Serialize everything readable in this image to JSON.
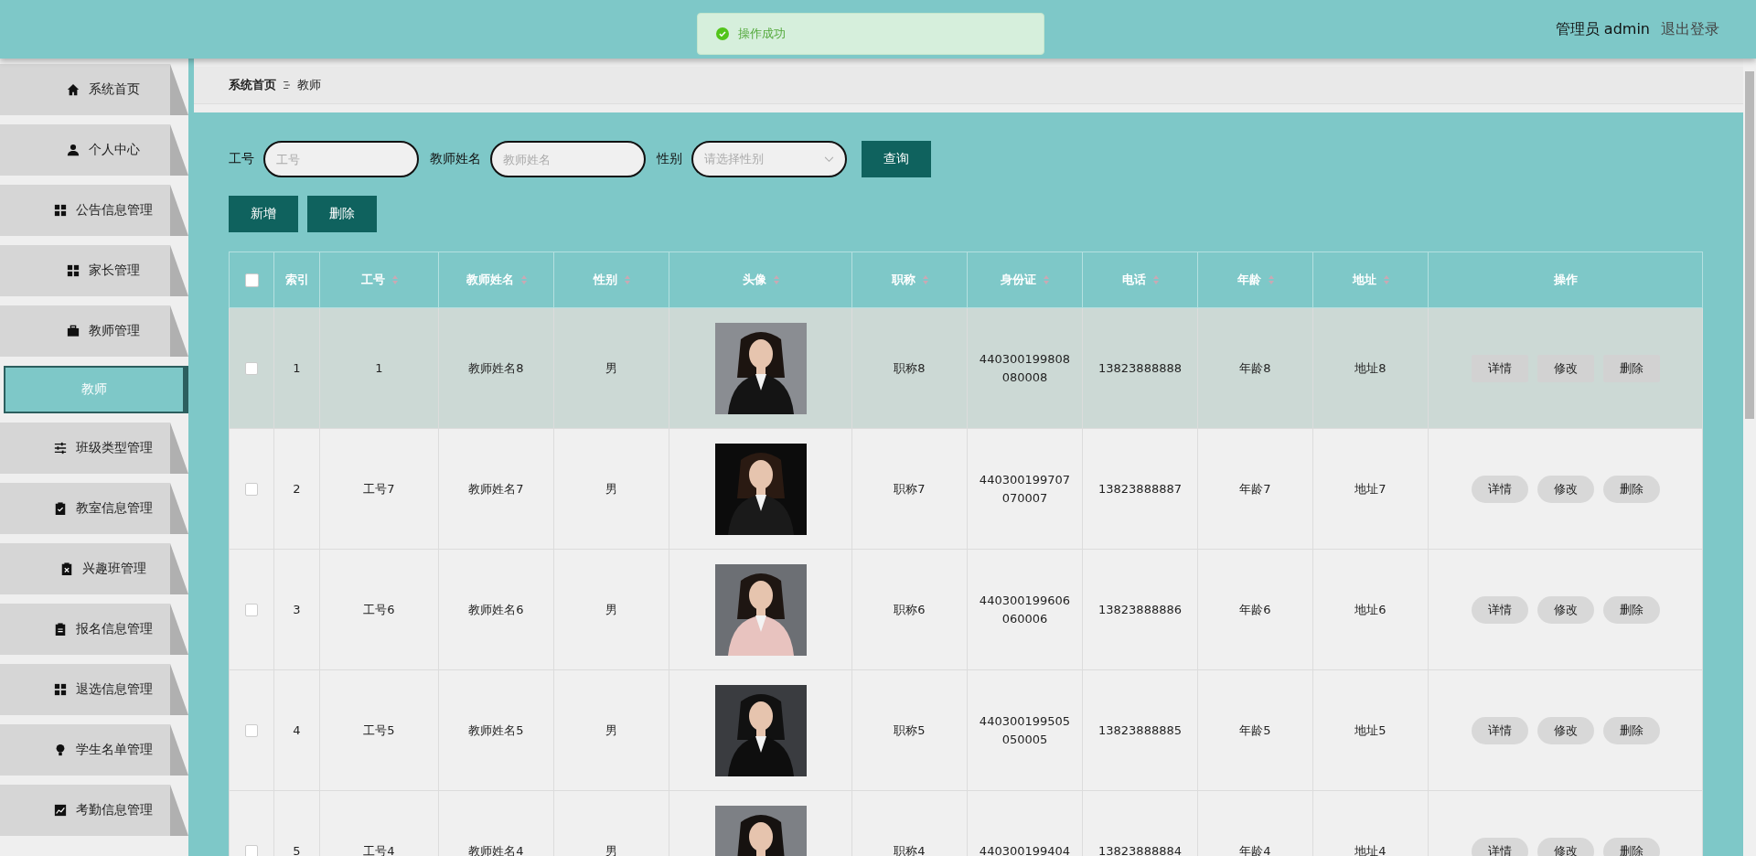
{
  "header": {
    "user": "管理员 admin",
    "logout": "退出登录"
  },
  "toast": {
    "message": "操作成功"
  },
  "sidebar": {
    "items": [
      {
        "label": "系统首页",
        "selected": false
      },
      {
        "label": "个人中心",
        "selected": false
      },
      {
        "label": "公告信息管理",
        "selected": false
      },
      {
        "label": "家长管理",
        "selected": false
      },
      {
        "label": "教师管理",
        "selected": false,
        "children": [
          {
            "label": "教师",
            "selected": true
          }
        ]
      },
      {
        "label": "班级类型管理",
        "selected": false
      },
      {
        "label": "教室信息管理",
        "selected": false
      },
      {
        "label": "兴趣班管理",
        "selected": false
      },
      {
        "label": "报名信息管理",
        "selected": false
      },
      {
        "label": "退选信息管理",
        "selected": false
      },
      {
        "label": "学生名单管理",
        "selected": false
      },
      {
        "label": "考勤信息管理",
        "selected": false
      }
    ]
  },
  "breadcrumb": [
    "系统首页",
    "教师"
  ],
  "search": {
    "fields": [
      {
        "kind": "input",
        "label": "工号",
        "placeholder": "工号"
      },
      {
        "kind": "input",
        "label": "教师姓名",
        "placeholder": "教师姓名"
      },
      {
        "kind": "select",
        "label": "性别",
        "placeholder": "请选择性别"
      }
    ],
    "button": "查询"
  },
  "actions": [
    "新增",
    "删除"
  ],
  "table": {
    "columns": [
      {
        "label": "索引",
        "sortable": false
      },
      {
        "label": "工号",
        "sortable": true
      },
      {
        "label": "教师姓名",
        "sortable": true
      },
      {
        "label": "性别",
        "sortable": true
      },
      {
        "label": "头像",
        "sortable": true
      },
      {
        "label": "职称",
        "sortable": true
      },
      {
        "label": "身份证",
        "sortable": true
      },
      {
        "label": "电话",
        "sortable": true
      },
      {
        "label": "年龄",
        "sortable": true
      },
      {
        "label": "地址",
        "sortable": true
      },
      {
        "label": "操作",
        "sortable": false
      }
    ],
    "select_all_checked": false,
    "rows": [
      {
        "checked": false,
        "selected": true,
        "cells": [
          "1",
          "1",
          "教师姓名8",
          "男",
          {
            "kind": "picture"
          },
          "职称8",
          "440300199808080008",
          "13823888888",
          "年龄8",
          "地址8"
        ],
        "buttons": [
          "详情",
          "修改",
          "删除"
        ]
      },
      {
        "checked": false,
        "selected": false,
        "cells": [
          "2",
          "工号7",
          "教师姓名7",
          "男",
          {
            "kind": "picture"
          },
          "职称7",
          "440300199707070007",
          "13823888887",
          "年龄7",
          "地址7"
        ],
        "buttons": [
          "详情",
          "修改",
          "删除"
        ]
      },
      {
        "checked": false,
        "selected": false,
        "cells": [
          "3",
          "工号6",
          "教师姓名6",
          "男",
          {
            "kind": "picture"
          },
          "职称6",
          "440300199606060006",
          "13823888886",
          "年龄6",
          "地址6"
        ],
        "buttons": [
          "详情",
          "修改",
          "删除"
        ]
      },
      {
        "checked": false,
        "selected": false,
        "cells": [
          "4",
          "工号5",
          "教师姓名5",
          "男",
          {
            "kind": "picture"
          },
          "职称5",
          "440300199505050005",
          "13823888885",
          "年龄5",
          "地址5"
        ],
        "buttons": [
          "详情",
          "修改",
          "删除"
        ]
      },
      {
        "checked": false,
        "selected": false,
        "cells": [
          "5",
          "工号4",
          "教师姓名4",
          "男",
          {
            "kind": "picture"
          },
          "职称4",
          "440300199404",
          "13823888884",
          "年龄4",
          "地址4"
        ],
        "buttons": [
          "详情",
          "修改",
          "删除"
        ]
      }
    ]
  }
}
